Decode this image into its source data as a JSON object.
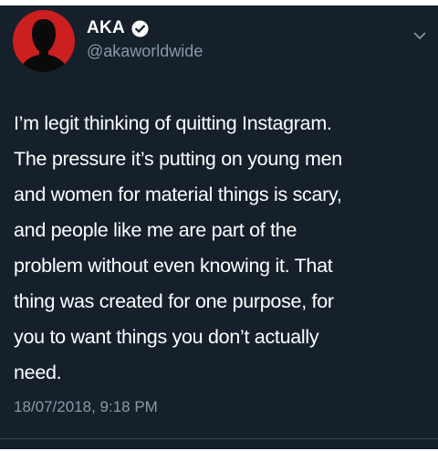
{
  "tweet": {
    "author": {
      "display_name": "AKA",
      "handle": "@akaworldwide",
      "avatar_icon": "person-silhouette-icon",
      "avatar_color": "#cc1f1f",
      "verified": true,
      "verified_icon": "verified-badge-icon"
    },
    "menu_icon": "chevron-down-icon",
    "text_lines": [
      "I’m legit thinking of quitting Instagram.",
      "The pressure it’s putting on young men",
      "and women for material things is scary,",
      "and people like me are part of the",
      "problem without even knowing it. That",
      "thing was created for one purpose, for",
      "you to want things you don’t actually",
      "need."
    ],
    "timestamp": "18/07/2018, 9:18 PM"
  },
  "colors": {
    "background": "#15202b",
    "text": "#ffffff",
    "secondary_text": "#8899a6",
    "divider": "#38444d"
  }
}
